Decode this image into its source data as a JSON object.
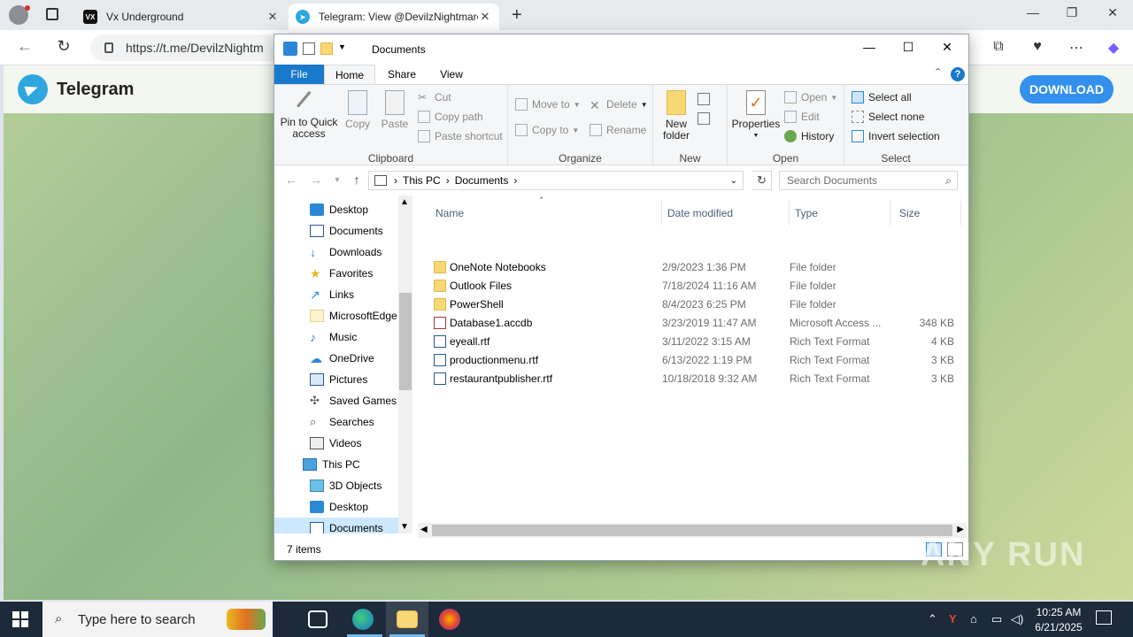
{
  "browser": {
    "tabs": [
      {
        "favicon": "VX",
        "title": "Vx Underground"
      },
      {
        "title": "Telegram: View @DevilzNightmare"
      }
    ],
    "url": "https://t.me/DevilzNightm"
  },
  "telegram": {
    "brand": "Telegram",
    "download_label": "DOWNLOAD"
  },
  "explorer": {
    "title": "Documents",
    "ribbon_tabs": {
      "file": "File",
      "home": "Home",
      "share": "Share",
      "view": "View"
    },
    "clipboard": {
      "pin_label": "Pin to Quick access",
      "copy_label": "Copy",
      "paste_label": "Paste",
      "cut_label": "Cut",
      "copy_path_label": "Copy path",
      "paste_shortcut_label": "Paste shortcut",
      "group_label": "Clipboard"
    },
    "organize": {
      "move_to_label": "Move to",
      "copy_to_label": "Copy to",
      "delete_label": "Delete",
      "rename_label": "Rename",
      "group_label": "Organize"
    },
    "new": {
      "new_folder_label": "New folder",
      "group_label": "New"
    },
    "open": {
      "properties_label": "Properties",
      "open_label": "Open",
      "edit_label": "Edit",
      "history_label": "History",
      "group_label": "Open"
    },
    "select": {
      "select_all_label": "Select all",
      "select_none_label": "Select none",
      "invert_label": "Invert selection",
      "group_label": "Select"
    },
    "address": {
      "crumbs": [
        "This PC",
        "Documents"
      ],
      "search_placeholder": "Search Documents"
    },
    "nav_items": [
      {
        "label": "Desktop",
        "icon": "desktop-icon"
      },
      {
        "label": "Documents",
        "icon": "documents-icon"
      },
      {
        "label": "Downloads",
        "icon": "downloads-icon"
      },
      {
        "label": "Favorites",
        "icon": "star-icon"
      },
      {
        "label": "Links",
        "icon": "link-icon"
      },
      {
        "label": "MicrosoftEdge",
        "icon": "folder-icon"
      },
      {
        "label": "Music",
        "icon": "music-icon"
      },
      {
        "label": "OneDrive",
        "icon": "cloud-icon"
      },
      {
        "label": "Pictures",
        "icon": "pictures-icon"
      },
      {
        "label": "Saved Games",
        "icon": "games-icon"
      },
      {
        "label": "Searches",
        "icon": "search-icon"
      },
      {
        "label": "Videos",
        "icon": "videos-icon"
      },
      {
        "label": "This PC",
        "icon": "pc-icon"
      },
      {
        "label": "3D Objects",
        "icon": "3d-objects-icon"
      },
      {
        "label": "Desktop",
        "icon": "desktop-icon"
      },
      {
        "label": "Documents",
        "icon": "documents-icon"
      }
    ],
    "columns": {
      "name": "Name",
      "date": "Date modified",
      "type": "Type",
      "size": "Size"
    },
    "files": [
      {
        "name": "OneNote Notebooks",
        "date": "2/9/2023 1:36 PM",
        "type": "File folder",
        "size": "",
        "icon": "folder-icon"
      },
      {
        "name": "Outlook Files",
        "date": "7/18/2024 11:16 AM",
        "type": "File folder",
        "size": "",
        "icon": "folder-icon"
      },
      {
        "name": "PowerShell",
        "date": "8/4/2023 6:25 PM",
        "type": "File folder",
        "size": "",
        "icon": "folder-icon"
      },
      {
        "name": "Database1.accdb",
        "date": "3/23/2019 11:47 AM",
        "type": "Microsoft Access ...",
        "size": "348 KB",
        "icon": "access-file-icon"
      },
      {
        "name": "eyeall.rtf",
        "date": "3/11/2022 3:15 AM",
        "type": "Rich Text Format",
        "size": "4 KB",
        "icon": "rtf-file-icon"
      },
      {
        "name": "productionmenu.rtf",
        "date": "6/13/2022 1:19 PM",
        "type": "Rich Text Format",
        "size": "3 KB",
        "icon": "rtf-file-icon"
      },
      {
        "name": "restaurantpublisher.rtf",
        "date": "10/18/2018 9:32 AM",
        "type": "Rich Text Format",
        "size": "3 KB",
        "icon": "rtf-file-icon"
      }
    ],
    "status": "7 items"
  },
  "taskbar": {
    "search_placeholder": "Type here to search",
    "time": "10:25 AM",
    "date": "6/21/2025"
  },
  "watermark": "ANY RUN"
}
